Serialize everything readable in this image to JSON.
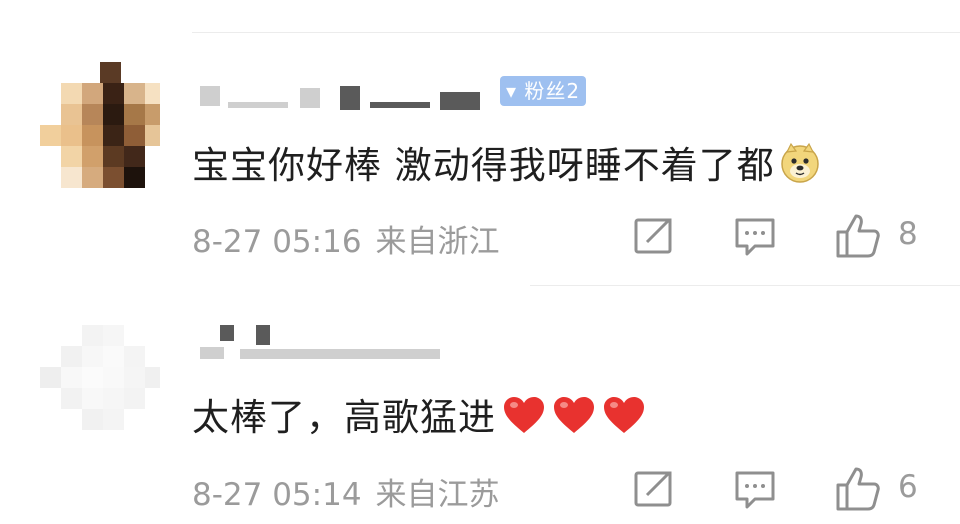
{
  "comments": [
    {
      "badge": "▾ 粉丝2",
      "text": "宝宝你好棒 激动得我呀睡不着了都",
      "emoji": "doge-face",
      "date": "8-27 05:16",
      "location": "来自浙江",
      "likes": "8"
    },
    {
      "text": "太棒了，高歌猛进",
      "emoji": "red-heart ×3",
      "date": "8-27 05:14",
      "location": "来自江苏",
      "likes": "6"
    }
  ],
  "icons": {
    "share": "share-icon",
    "comment": "comment-icon",
    "like": "like-icon"
  },
  "colors": {
    "meta_gray": "#9b9b9b",
    "badge_blue": "#9ec0f0",
    "heart_red": "#e8322f"
  }
}
